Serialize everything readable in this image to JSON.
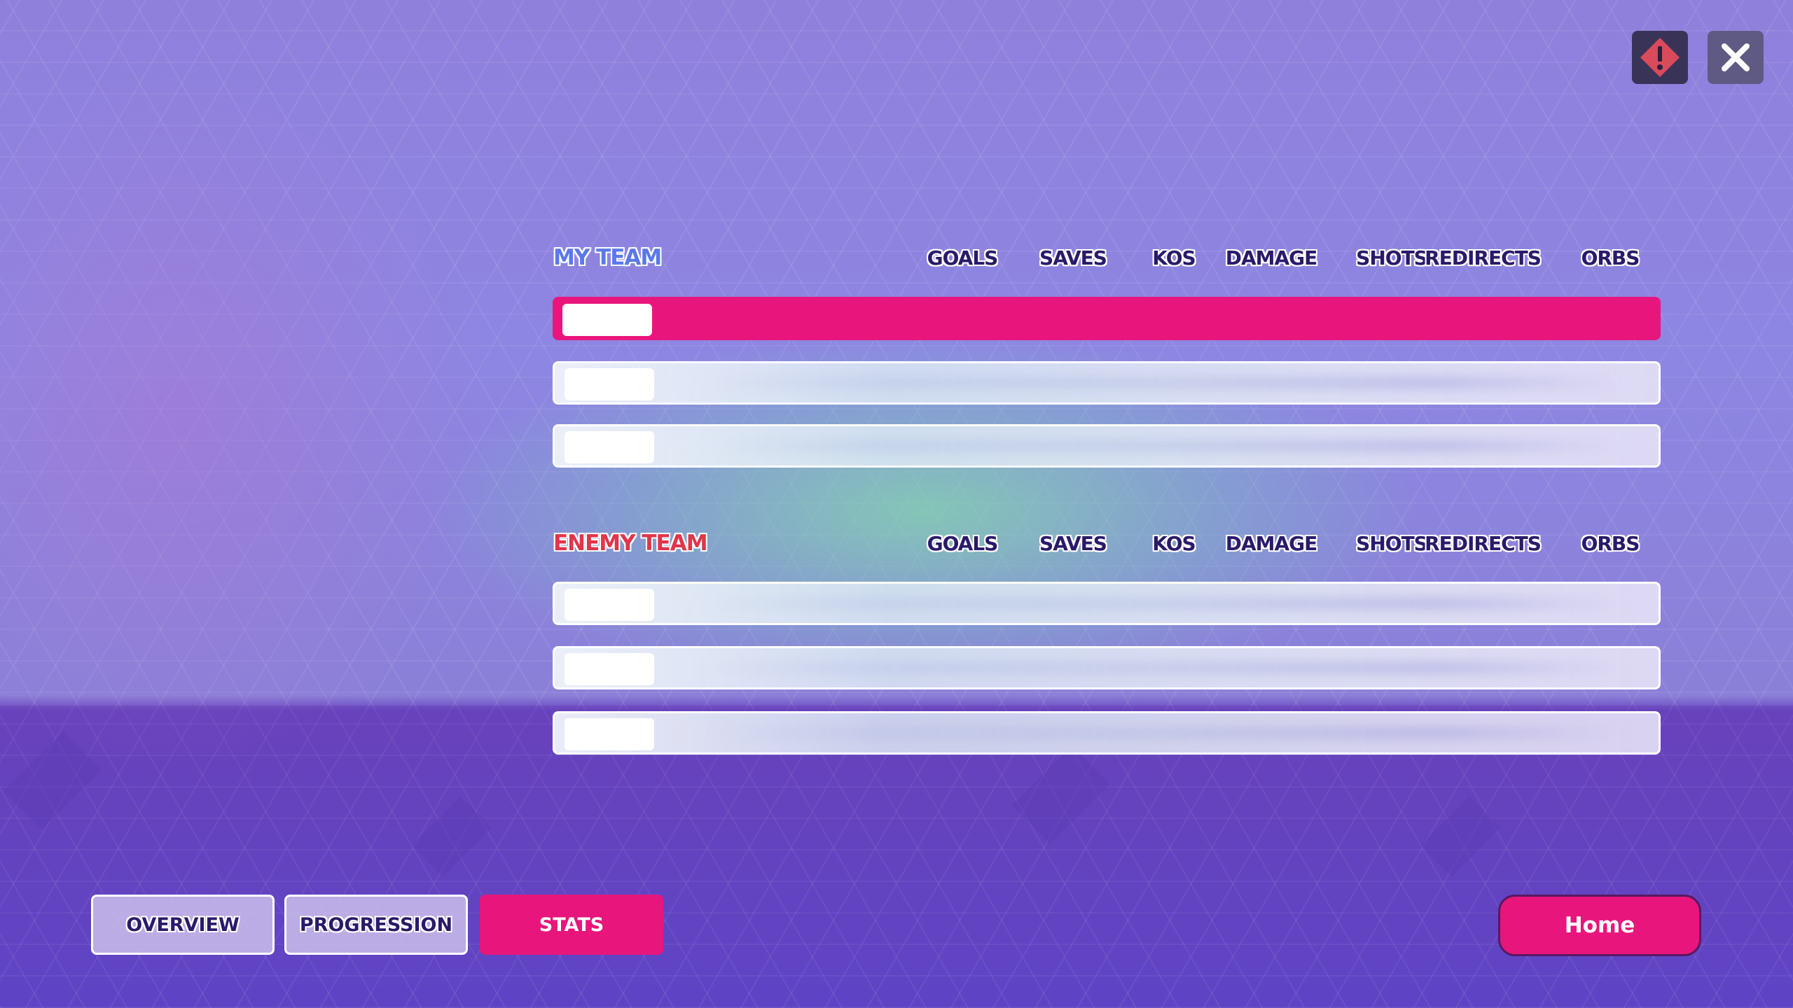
{
  "topbar": {
    "report_icon": "warning-diamond-icon",
    "close_icon": "close-x-icon"
  },
  "my_team": {
    "title": "MY TEAM",
    "title_color": "#5a78ea",
    "columns": [
      "GOALS",
      "SAVES",
      "KOS",
      "DAMAGE",
      "SHOTS",
      "REDIRECTS",
      "ORBS"
    ],
    "rows": [
      {
        "highlight": true
      },
      {
        "highlight": false
      },
      {
        "highlight": false
      }
    ]
  },
  "enemy_team": {
    "title": "ENEMY TEAM",
    "title_color": "#e2344a",
    "columns": [
      "GOALS",
      "SAVES",
      "KOS",
      "DAMAGE",
      "SHOTS",
      "REDIRECTS",
      "ORBS"
    ],
    "rows": [
      {
        "highlight": false
      },
      {
        "highlight": false
      },
      {
        "highlight": false
      }
    ]
  },
  "tabs": [
    {
      "label": "OVERVIEW",
      "active": false
    },
    {
      "label": "PROGRESSION",
      "active": false
    },
    {
      "label": "STATS",
      "active": true
    }
  ],
  "home_button": {
    "label": "Home"
  },
  "colors": {
    "accent": "#e8167c",
    "text_dark": "#2a1a6a"
  }
}
